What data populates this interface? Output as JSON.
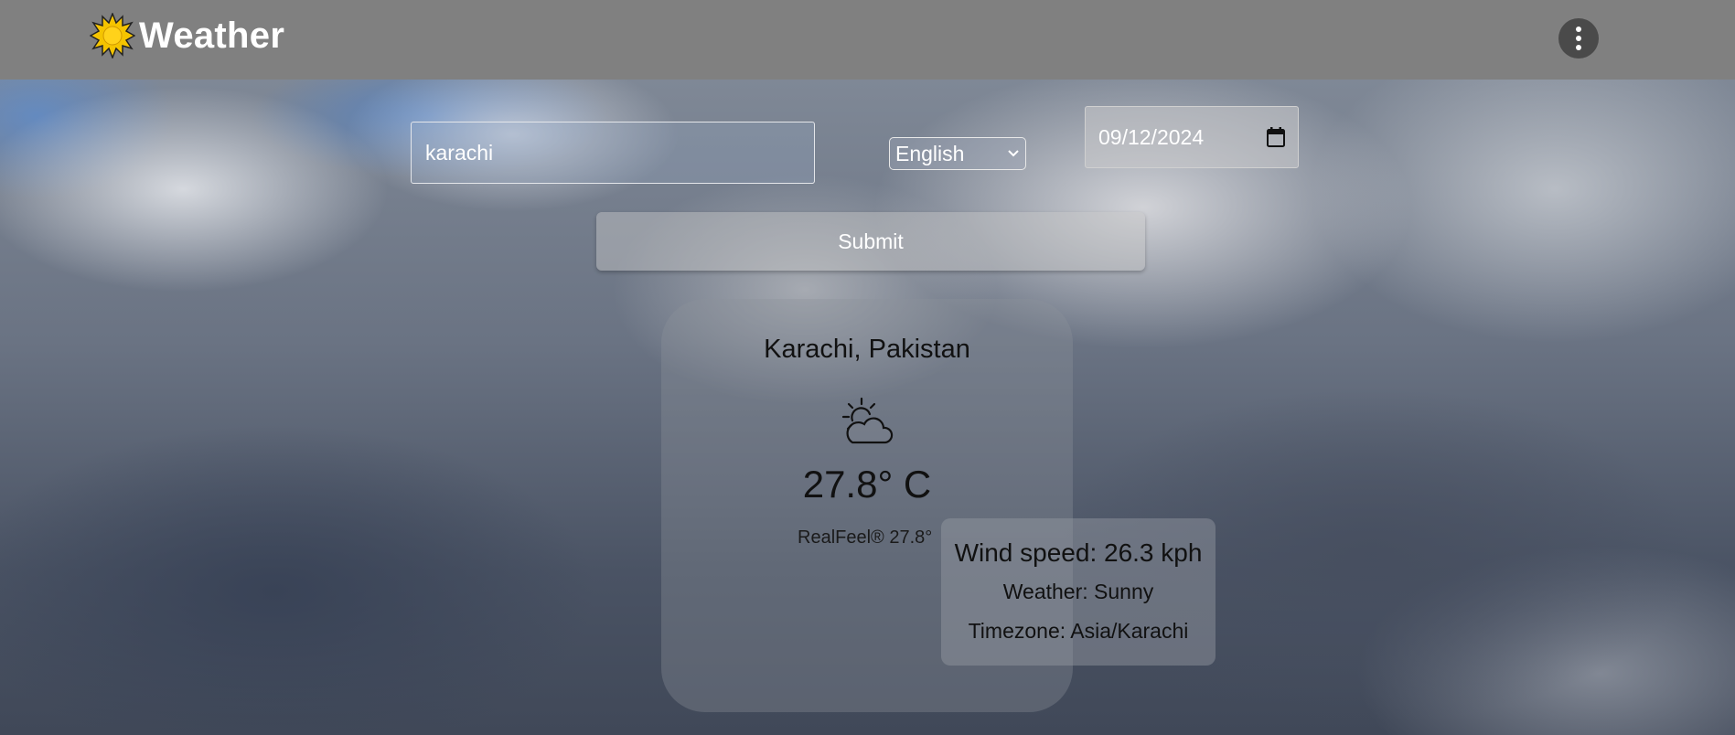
{
  "app": {
    "title": "Weather",
    "logo_icon": "sun-icon",
    "menu_icon": "kebab-menu-icon",
    "colors": {
      "topbar": "#808080",
      "sun": "#f5c400",
      "text_dark": "#111111",
      "text_light": "#ffffff"
    }
  },
  "search": {
    "value": "karachi",
    "placeholder": ""
  },
  "language": {
    "selected": "English"
  },
  "date": {
    "value": "09/12/2024",
    "icon": "calendar-icon"
  },
  "submit": {
    "label": "Submit"
  },
  "weather": {
    "location": "Karachi, Pakistan",
    "condition_icon": "partly-cloudy-icon",
    "temperature": "27.8° C",
    "realfeel": "RealFeel® 27.8°",
    "wind": "Wind speed: 26.3 kph",
    "condition": "Weather: Sunny",
    "timezone": "Timezone: Asia/Karachi"
  }
}
